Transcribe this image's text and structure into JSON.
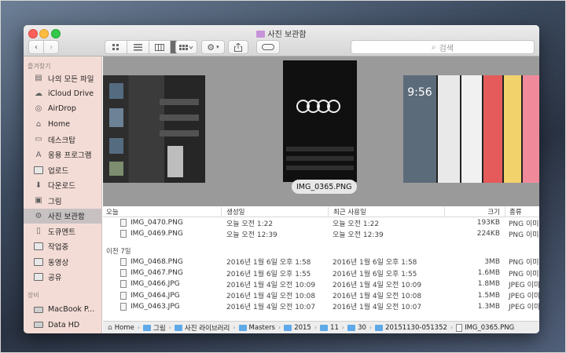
{
  "window": {
    "title": "사진 보관함"
  },
  "toolbar": {
    "back": "‹",
    "forward": "›",
    "search_placeholder": "검색"
  },
  "sidebar": {
    "favorites_header": "즐겨찾기",
    "items": [
      {
        "label": "나의 모든 파일",
        "icon": "all-files-icon"
      },
      {
        "label": "iCloud Drive",
        "icon": "cloud-icon"
      },
      {
        "label": "AirDrop",
        "icon": "airdrop-icon"
      },
      {
        "label": "Home",
        "icon": "home-icon"
      },
      {
        "label": "데스크탑",
        "icon": "desktop-icon"
      },
      {
        "label": "응용 프로그램",
        "icon": "applications-icon"
      },
      {
        "label": "업로드",
        "icon": "folder-icon"
      },
      {
        "label": "다운로드",
        "icon": "download-icon"
      },
      {
        "label": "그림",
        "icon": "pictures-icon"
      },
      {
        "label": "사진 보관함",
        "icon": "gear-icon"
      },
      {
        "label": "도큐멘트",
        "icon": "document-icon"
      },
      {
        "label": "작업중",
        "icon": "folder-icon"
      },
      {
        "label": "동영상",
        "icon": "folder-icon"
      },
      {
        "label": "공유",
        "icon": "folder-icon"
      }
    ],
    "devices_header": "장비",
    "devices": [
      {
        "label": "MacBook P...",
        "icon": "laptop-icon"
      },
      {
        "label": "Data HD",
        "icon": "disk-icon"
      }
    ]
  },
  "coverflow": {
    "selected_caption": "IMG_0365.PNG",
    "phone_time": "9:56"
  },
  "columns": {
    "name": "오늘",
    "created": "생성일",
    "last_used": "최근 사용일",
    "size": "크기",
    "kind": "종류"
  },
  "groups": [
    {
      "label": "",
      "files": [
        {
          "name": "IMG_0470.PNG",
          "created": "오늘 오전 1:22",
          "used": "오늘 오전 1:22",
          "size": "193KB",
          "kind": "PNG 이미지"
        },
        {
          "name": "IMG_0469.PNG",
          "created": "오늘 오전 12:39",
          "used": "오늘 오전 12:39",
          "size": "224KB",
          "kind": "PNG 이미지"
        }
      ]
    },
    {
      "label": "이전 7일",
      "files": [
        {
          "name": "IMG_0468.PNG",
          "created": "2016년 1월 6일 오후 1:58",
          "used": "2016년 1월 6일 오후 1:58",
          "size": "3MB",
          "kind": "PNG 이미지"
        },
        {
          "name": "IMG_0467.PNG",
          "created": "2016년 1월 6일 오후 1:55",
          "used": "2016년 1월 6일 오후 1:55",
          "size": "1.6MB",
          "kind": "PNG 이미지"
        },
        {
          "name": "IMG_0466.JPG",
          "created": "2016년 1월 4일 오전 10:09",
          "used": "2016년 1월 4일 오전 10:09",
          "size": "1.8MB",
          "kind": "JPEG 이미지"
        },
        {
          "name": "IMG_0464.JPG",
          "created": "2016년 1월 4일 오전 10:08",
          "used": "2016년 1월 4일 오전 10:08",
          "size": "1.5MB",
          "kind": "JPEG 이미지"
        },
        {
          "name": "IMG_0463.JPG",
          "created": "2016년 1월 4일 오전 10:07",
          "used": "2016년 1월 4일 오전 10:07",
          "size": "1.3MB",
          "kind": "JPEG 이미지"
        }
      ]
    }
  ],
  "pathbar": {
    "segments": [
      "Home",
      "그림",
      "사진 라이브러리",
      "Masters",
      "2015",
      "11",
      "30",
      "20151130-051352",
      "IMG_0365.PNG"
    ]
  }
}
